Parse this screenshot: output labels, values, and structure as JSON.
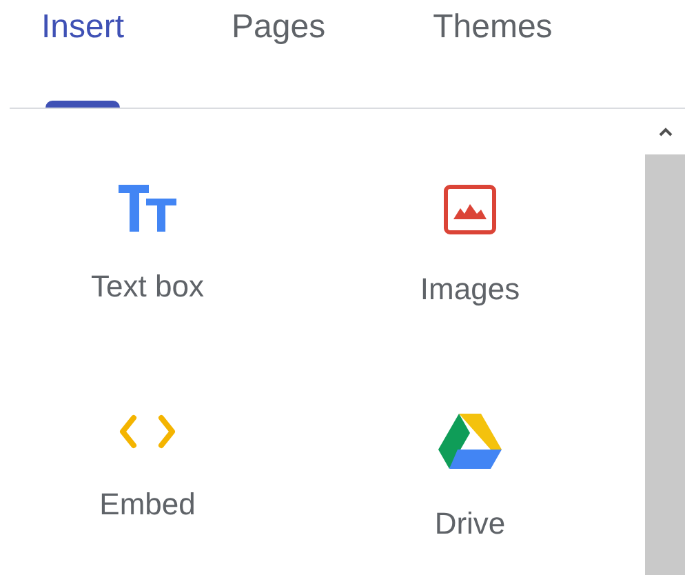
{
  "tabs": [
    {
      "label": "Insert",
      "selected": true
    },
    {
      "label": "Pages",
      "selected": false
    },
    {
      "label": "Themes",
      "selected": false
    }
  ],
  "insert_items": [
    {
      "label": "Text box",
      "kind": "textbox"
    },
    {
      "label": "Images",
      "kind": "image"
    },
    {
      "label": "Embed",
      "kind": "embed"
    },
    {
      "label": "Drive",
      "kind": "drive"
    }
  ]
}
